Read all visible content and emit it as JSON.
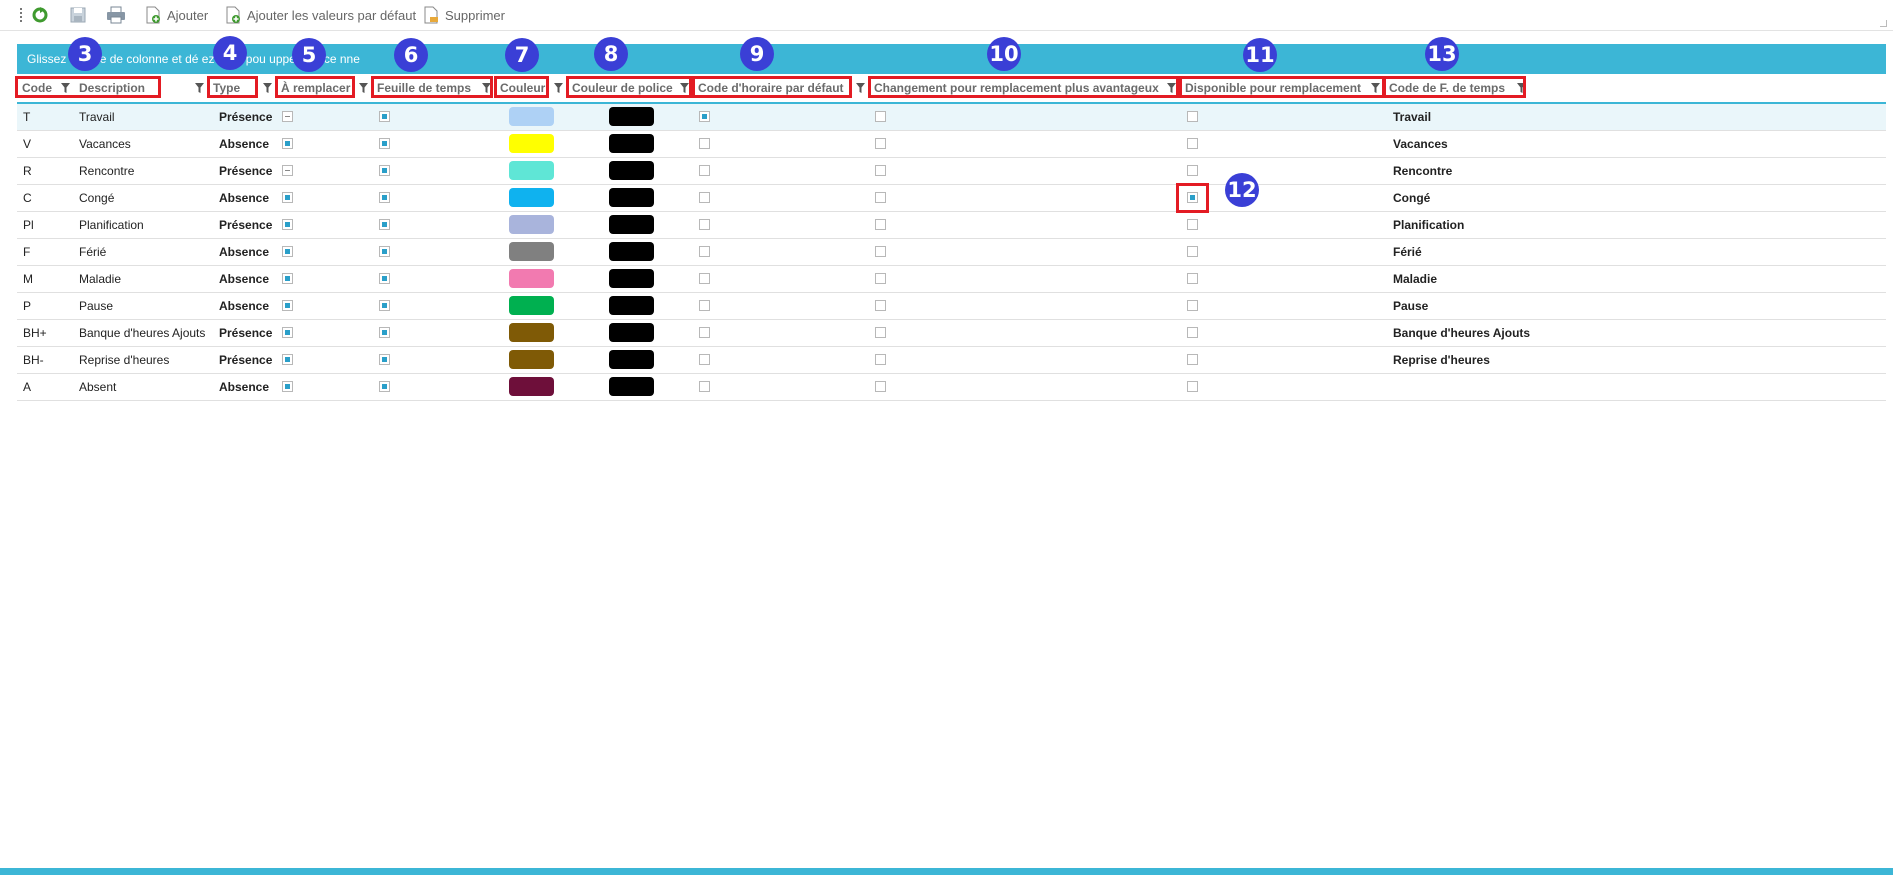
{
  "toolbar": {
    "refresh_label": "",
    "add_label": "Ajouter",
    "add_defaults_label": "Ajouter les valeurs par défaut",
    "delete_label": "Supprimer"
  },
  "group_panel": {
    "text": "Glissez un tête de colonne et dé ez-là ici pou upper par ce nne"
  },
  "columns": {
    "code": "Code",
    "description": "Description",
    "type": "Type",
    "a_remplacer": "À remplacer",
    "feuille": "Feuille de temps",
    "couleur": "Couleur",
    "couleur_police": "Couleur de police",
    "code_horaire": "Code d'horaire par défaut",
    "changement": "Changement pour remplacement plus avantageux",
    "disponible": "Disponible pour remplacement",
    "code_ft": "Code de F. de temps"
  },
  "badges": [
    "3",
    "4",
    "5",
    "6",
    "7",
    "8",
    "9",
    "10",
    "11",
    "12",
    "13"
  ],
  "rows": [
    {
      "code": "T",
      "description": "Travail",
      "type": "Présence",
      "a_remplacer": "ind",
      "feuille": "on",
      "couleur": "#aed1f5",
      "police": "#000000",
      "horaire": "on",
      "changement": "off",
      "disponible": "off",
      "code_ft": "Travail"
    },
    {
      "code": "V",
      "description": "Vacances",
      "type": "Absence",
      "a_remplacer": "on",
      "feuille": "on",
      "couleur": "#ffff00",
      "police": "#000000",
      "horaire": "off",
      "changement": "off",
      "disponible": "off",
      "code_ft": "Vacances"
    },
    {
      "code": "R",
      "description": "Rencontre",
      "type": "Présence",
      "a_remplacer": "ind",
      "feuille": "on",
      "couleur": "#5fe6d6",
      "police": "#000000",
      "horaire": "off",
      "changement": "off",
      "disponible": "off",
      "code_ft": "Rencontre"
    },
    {
      "code": "C",
      "description": "Congé",
      "type": "Absence",
      "a_remplacer": "on",
      "feuille": "on",
      "couleur": "#0fb2ef",
      "police": "#000000",
      "horaire": "off",
      "changement": "off",
      "disponible": "on",
      "code_ft": "Congé"
    },
    {
      "code": "Pl",
      "description": "Planification",
      "type": "Présence",
      "a_remplacer": "on",
      "feuille": "on",
      "couleur": "#a9b4dc",
      "police": "#000000",
      "horaire": "off",
      "changement": "off",
      "disponible": "off",
      "code_ft": "Planification"
    },
    {
      "code": "F",
      "description": "Férié",
      "type": "Absence",
      "a_remplacer": "on",
      "feuille": "on",
      "couleur": "#808080",
      "police": "#000000",
      "horaire": "off",
      "changement": "off",
      "disponible": "off",
      "code_ft": "Férié"
    },
    {
      "code": "M",
      "description": "Maladie",
      "type": "Absence",
      "a_remplacer": "on",
      "feuille": "on",
      "couleur": "#f27ab0",
      "police": "#000000",
      "horaire": "off",
      "changement": "off",
      "disponible": "off",
      "code_ft": "Maladie"
    },
    {
      "code": "P",
      "description": "Pause",
      "type": "Absence",
      "a_remplacer": "on",
      "feuille": "on",
      "couleur": "#00b050",
      "police": "#000000",
      "horaire": "off",
      "changement": "off",
      "disponible": "off",
      "code_ft": "Pause"
    },
    {
      "code": "BH+",
      "description": "Banque d'heures Ajouts",
      "type": "Présence",
      "a_remplacer": "on",
      "feuille": "on",
      "couleur": "#7f5a06",
      "police": "#000000",
      "horaire": "off",
      "changement": "off",
      "disponible": "off",
      "code_ft": "Banque d'heures Ajouts"
    },
    {
      "code": "BH-",
      "description": "Reprise d'heures",
      "type": "Présence",
      "a_remplacer": "on",
      "feuille": "on",
      "couleur": "#7f5a06",
      "police": "#000000",
      "horaire": "off",
      "changement": "off",
      "disponible": "off",
      "code_ft": "Reprise d'heures"
    },
    {
      "code": "A",
      "description": "Absent",
      "type": "Absence",
      "a_remplacer": "on",
      "feuille": "on",
      "couleur": "#6e0f3a",
      "police": "#000000",
      "horaire": "off",
      "changement": "off",
      "disponible": "off",
      "code_ft": ""
    }
  ],
  "colors": {
    "accent": "#3cb6d6",
    "highlight": "#e31b23",
    "badge": "#3a3fd6"
  }
}
